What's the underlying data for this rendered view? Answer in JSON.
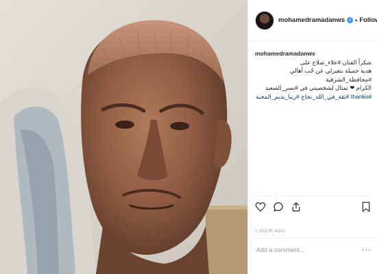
{
  "header": {
    "username": "mohamedramadanws",
    "follow_label": "Following",
    "dot": "•",
    "verified_icon": "verified-check-icon"
  },
  "caption": {
    "username": "mohamedramadanws",
    "line1": "شكراً الفنان #علاء_صلاح على",
    "line2": "هدية جميلة بتعبرلي عن حُب أهالي #محافظة_الشرقية",
    "line3": "الكرام ❤ تمثال لشخصيتي في #نسر_الصعيد",
    "line4": "#thanks #ثقة_في_الله_نجاح #ربنا_يديم_المحبة"
  },
  "actions": {
    "like_icon": "heart-icon",
    "comment_icon": "comment-icon",
    "share_icon": "share-icon",
    "save_icon": "bookmark-icon"
  },
  "timestamp": "1 HOUR AGO",
  "comment": {
    "placeholder": "Add a comment...",
    "more_label": "···"
  },
  "colors": {
    "accent": "#3897f0",
    "hashtag": "#003569",
    "muted": "#999999",
    "border": "#efefef"
  }
}
